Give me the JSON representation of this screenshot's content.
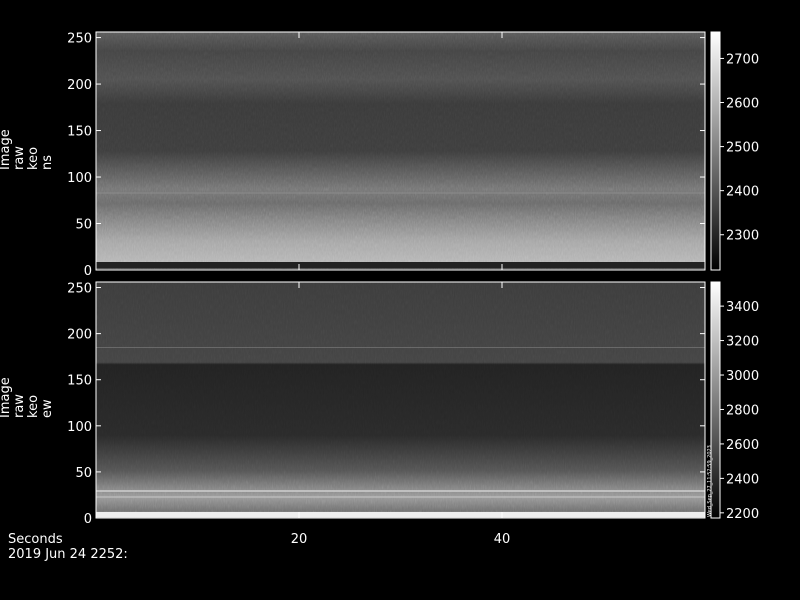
{
  "chart_data": [
    {
      "type": "heatmap",
      "ylabel_lines": [
        "Image",
        "raw",
        "keo",
        "ns"
      ],
      "ylim": [
        0,
        256
      ],
      "yticks": [
        0,
        50,
        100,
        150,
        200,
        250
      ],
      "colorbar": {
        "range": [
          2220,
          2760
        ],
        "ticks": [
          2300,
          2400,
          2500,
          2600,
          2700
        ]
      },
      "colormap": "grayscale"
    },
    {
      "type": "heatmap",
      "ylabel_lines": [
        "Image",
        "raw",
        "keo",
        "ew"
      ],
      "ylim": [
        0,
        256
      ],
      "yticks": [
        0,
        50,
        100,
        150,
        200,
        250
      ],
      "colorbar": {
        "range": [
          2170,
          3540
        ],
        "ticks": [
          2200,
          2400,
          2600,
          2800,
          3000,
          3200,
          3400
        ]
      },
      "colormap": "grayscale",
      "colorbar_annotation": "Wed_Sep_27_11:52:59_2023"
    }
  ],
  "xaxis": {
    "label": "Seconds",
    "date_label": "2019 Jun 24 2252:",
    "xlim": [
      0,
      60
    ],
    "ticks": [
      20,
      40
    ]
  }
}
